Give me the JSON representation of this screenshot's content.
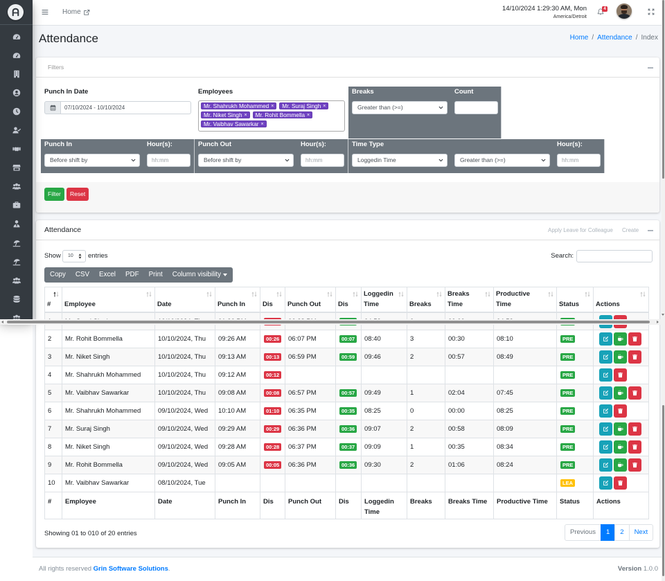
{
  "sidebar": {
    "items": [
      {
        "icon": "tachometer"
      },
      {
        "icon": "tachometer"
      },
      {
        "icon": "building"
      },
      {
        "icon": "user-circle"
      },
      {
        "icon": "clock"
      },
      {
        "icon": "user-check"
      },
      {
        "icon": "handshake"
      },
      {
        "icon": "store"
      },
      {
        "icon": "users"
      },
      {
        "icon": "briefcase"
      },
      {
        "icon": "user-tie"
      },
      {
        "icon": "umbrella-beach"
      },
      {
        "icon": "umbrella-beach"
      },
      {
        "icon": "users"
      },
      {
        "icon": "database"
      },
      {
        "icon": "users"
      }
    ]
  },
  "navbar": {
    "home_label": "Home",
    "datetime": "14/10/2024 1:29:30 AM, Mon",
    "timezone": "America/Detroit",
    "notification_count": "4"
  },
  "page": {
    "title": "Attendance",
    "breadcrumb": [
      {
        "label": "Home"
      },
      {
        "label": "Attendance"
      },
      {
        "label": "Index"
      }
    ],
    "breadcrumb_separator": "/"
  },
  "filters": {
    "title": "Filters",
    "punch_in_date": {
      "label": "Punch In Date",
      "value": "07/10/2024 - 10/10/2024"
    },
    "employees": {
      "label": "Employees",
      "selected": [
        "Mr. Shahrukh Mohammed",
        "Mr. Suraj Singh",
        "Mr. Niket Singh",
        "Mr. Rohit Bommella",
        "Mr. Vaibhav Sawarkar"
      ],
      "remove_glyph": "×"
    },
    "breaks": {
      "label": "Breaks",
      "operator": "Greater than (>=)",
      "count_label": "Count",
      "count_value": ""
    },
    "punch_in": {
      "label": "Punch In",
      "mode": "Before shift by",
      "hours_label": "Hour(s):",
      "hours_placeholder": "hh:mm"
    },
    "punch_out": {
      "label": "Punch Out",
      "mode": "Before shift by",
      "hours_label": "Hour(s):",
      "hours_placeholder": "hh:mm"
    },
    "time_type": {
      "label": "Time Type",
      "type": "Loggedin Time",
      "operator": "Greater than (>=)",
      "hours_label": "Hour(s):",
      "hours_placeholder": "hh:mm"
    },
    "filter_button": "Filter",
    "reset_button": "Reset"
  },
  "attendance": {
    "title": "Attendance",
    "apply_leave_link": "Apply Leave for Colleague",
    "create_link": "Create",
    "length": {
      "show_label": "Show",
      "value": "10",
      "entries_label": "entries"
    },
    "search": {
      "label": "Search:",
      "value": ""
    },
    "export_buttons": [
      "Copy",
      "CSV",
      "Excel",
      "PDF",
      "Print",
      "Column visibility"
    ],
    "sort": {
      "column": "no",
      "direction": "asc"
    },
    "columns": [
      {
        "key": "no",
        "label": "#"
      },
      {
        "key": "employee",
        "label": "Employee"
      },
      {
        "key": "date",
        "label": "Date"
      },
      {
        "key": "punch_in",
        "label": "Punch In"
      },
      {
        "key": "punch_in_dis",
        "label": "Dis"
      },
      {
        "key": "punch_out",
        "label": "Punch Out"
      },
      {
        "key": "punch_out_dis",
        "label": "Dis"
      },
      {
        "key": "loggedin_time",
        "label": "Loggedin Time"
      },
      {
        "key": "breaks",
        "label": "Breaks"
      },
      {
        "key": "breaks_time",
        "label": "Breaks Time"
      },
      {
        "key": "productive_time",
        "label": "Productive Time"
      },
      {
        "key": "status",
        "label": "Status"
      },
      {
        "key": "actions",
        "label": "Actions"
      }
    ],
    "rows": [
      {
        "no": "1",
        "employee": "Mr. Suraj Singh",
        "date": "10/10/2024, Thu",
        "punch_in": "01:36 PM",
        "punch_in_dis": "04:36",
        "punch_out": "06:28 PM",
        "punch_out_dis": "00:28",
        "loggedin_time": "04:52",
        "breaks": "0",
        "breaks_time": "00:00",
        "productive_time": "04:52",
        "status": "PRE",
        "actions": [
          "edit",
          "delete"
        ]
      },
      {
        "no": "2",
        "employee": "Mr. Rohit Bommella",
        "date": "10/10/2024, Thu",
        "punch_in": "09:26 AM",
        "punch_in_dis": "00:26",
        "punch_out": "06:07 PM",
        "punch_out_dis": "00:07",
        "loggedin_time": "08:40",
        "breaks": "3",
        "breaks_time": "00:30",
        "productive_time": "08:10",
        "status": "PRE",
        "actions": [
          "edit",
          "breaks",
          "delete"
        ]
      },
      {
        "no": "3",
        "employee": "Mr. Niket Singh",
        "date": "10/10/2024, Thu",
        "punch_in": "09:13 AM",
        "punch_in_dis": "00:13",
        "punch_out": "06:59 PM",
        "punch_out_dis": "00:59",
        "loggedin_time": "09:46",
        "breaks": "2",
        "breaks_time": "00:57",
        "productive_time": "08:49",
        "status": "PRE",
        "actions": [
          "edit",
          "breaks",
          "delete"
        ]
      },
      {
        "no": "4",
        "employee": "Mr. Shahrukh Mohammed",
        "date": "10/10/2024, Thu",
        "punch_in": "09:12 AM",
        "punch_in_dis": "00:12",
        "punch_out": "",
        "punch_out_dis": "",
        "loggedin_time": "",
        "breaks": "",
        "breaks_time": "",
        "productive_time": "",
        "status": "PRE",
        "actions": [
          "edit",
          "delete"
        ]
      },
      {
        "no": "5",
        "employee": "Mr. Vaibhav Sawarkar",
        "date": "10/10/2024, Thu",
        "punch_in": "09:08 AM",
        "punch_in_dis": "00:08",
        "punch_out": "06:57 PM",
        "punch_out_dis": "00:57",
        "loggedin_time": "09:49",
        "breaks": "1",
        "breaks_time": "02:04",
        "productive_time": "07:45",
        "status": "PRE",
        "actions": [
          "edit",
          "breaks",
          "delete"
        ]
      },
      {
        "no": "6",
        "employee": "Mr. Shahrukh Mohammed",
        "date": "09/10/2024, Wed",
        "punch_in": "10:10 AM",
        "punch_in_dis": "01:10",
        "punch_out": "06:35 PM",
        "punch_out_dis": "00:35",
        "loggedin_time": "08:25",
        "breaks": "0",
        "breaks_time": "00:00",
        "productive_time": "08:25",
        "status": "PRE",
        "actions": [
          "edit",
          "delete"
        ]
      },
      {
        "no": "7",
        "employee": "Mr. Suraj Singh",
        "date": "09/10/2024, Wed",
        "punch_in": "09:29 AM",
        "punch_in_dis": "00:29",
        "punch_out": "06:36 PM",
        "punch_out_dis": "00:36",
        "loggedin_time": "09:07",
        "breaks": "2",
        "breaks_time": "00:58",
        "productive_time": "08:09",
        "status": "PRE",
        "actions": [
          "edit",
          "breaks",
          "delete"
        ]
      },
      {
        "no": "8",
        "employee": "Mr. Niket Singh",
        "date": "09/10/2024, Wed",
        "punch_in": "09:28 AM",
        "punch_in_dis": "00:28",
        "punch_out": "06:37 PM",
        "punch_out_dis": "00:37",
        "loggedin_time": "09:09",
        "breaks": "1",
        "breaks_time": "00:35",
        "productive_time": "08:34",
        "status": "PRE",
        "actions": [
          "edit",
          "breaks",
          "delete"
        ]
      },
      {
        "no": "9",
        "employee": "Mr. Rohit Bommella",
        "date": "09/10/2024, Wed",
        "punch_in": "09:05 AM",
        "punch_in_dis": "00:05",
        "punch_out": "06:36 PM",
        "punch_out_dis": "00:36",
        "loggedin_time": "09:30",
        "breaks": "2",
        "breaks_time": "01:06",
        "productive_time": "08:24",
        "status": "PRE",
        "actions": [
          "edit",
          "breaks",
          "delete"
        ]
      },
      {
        "no": "10",
        "employee": "Mr. Vaibhav Sawarkar",
        "date": "08/10/2024, Tue",
        "punch_in": "",
        "punch_in_dis": "",
        "punch_out": "",
        "punch_out_dis": "",
        "loggedin_time": "",
        "breaks": "",
        "breaks_time": "",
        "productive_time": "",
        "status": "LEA",
        "actions": [
          "edit",
          "delete"
        ]
      }
    ],
    "info": "Showing 01 to 010 of 20 entries",
    "pagination": {
      "previous": "Previous",
      "pages": [
        "1",
        "2"
      ],
      "active": "1",
      "next": "Next"
    }
  },
  "footer": {
    "prefix": "All rights reserved ",
    "company": "Grin Software Solutions",
    "suffix": ".",
    "version_label": "Version",
    "version": " 1.0.0"
  },
  "colors": {
    "primary": "#007bff",
    "success": "#28a745",
    "danger": "#dc3545",
    "warning": "#ffc107",
    "info": "#17a2b8",
    "secondary": "#6c757d",
    "sidebar": "#343a40",
    "tag": "#6f42c1",
    "status": {
      "PRE": "#28a745",
      "LEA": "#ffc107"
    },
    "punch_in_dis": "#dc3545",
    "punch_out_dis": "#28a745"
  }
}
